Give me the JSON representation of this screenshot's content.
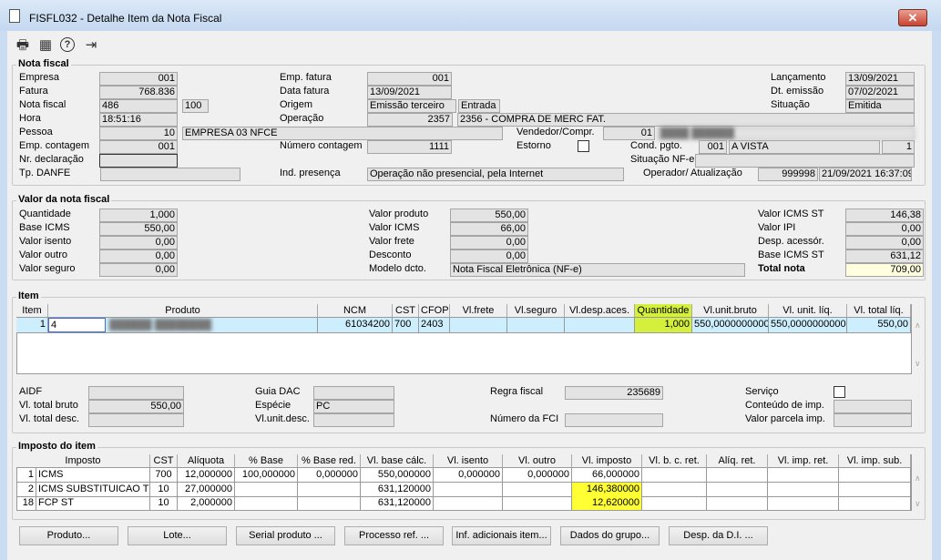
{
  "window": {
    "title": "FISFL032 - Detalhe Item da Nota Fiscal",
    "close": "✕"
  },
  "toolbar": {
    "print": "🖶",
    "calendar": "▦",
    "help": "?",
    "exit": "⇥"
  },
  "nota_fiscal": {
    "title": "Nota fiscal",
    "empresa_label": "Empresa",
    "empresa": "001",
    "fatura_label": "Fatura",
    "fatura": "768.836",
    "nota_label": "Nota fiscal",
    "nota": "486",
    "serie": "100",
    "hora_label": "Hora",
    "hora": "18:51:16",
    "pessoa_label": "Pessoa",
    "pessoa": "10",
    "pessoa_nome": "EMPRESA 03 NFCE",
    "emp_contagem_label": "Emp. contagem",
    "emp_contagem": "001",
    "nr_declaracao_label": "Nr. declaração",
    "nr_declaracao": "",
    "tp_danfe_label": "Tp. DANFE",
    "tp_danfe": "",
    "emp_fatura_label": "Emp. fatura",
    "emp_fatura": "001",
    "data_fatura_label": "Data fatura",
    "data_fatura": "13/09/2021",
    "origem_label": "Origem",
    "origem": "Emissão terceiro",
    "origem_tipo": "Entrada",
    "operacao_label": "Operação",
    "operacao": "2357",
    "operacao_desc": "2356 - COMPRA DE MERC FAT.",
    "numero_contagem_label": "Número contagem",
    "numero_contagem": "1111",
    "ind_presenca_label": "Ind. presença",
    "ind_presenca": "Operação não presencial, pela Internet",
    "vendedor_label": "Vendedor/Compr.",
    "vendedor": "01",
    "vendedor_nome": "████ ██████",
    "estorno_label": "Estorno",
    "estorno": false,
    "cond_pgto_label": "Cond. pgto.",
    "cond_pgto": "001",
    "cond_pgto_desc": "A VISTA",
    "cond_pgto_parcelas": "1",
    "situacao_nfe_label": "Situação NF-e",
    "situacao_nfe": "",
    "operador_label": "Operador/ Atualização",
    "operador": "999998",
    "atualizacao": "21/09/2021 16:37:09",
    "lancamento_label": "Lançamento",
    "lancamento": "13/09/2021",
    "dt_emissao_label": "Dt. emissão",
    "dt_emissao": "07/02/2021",
    "situacao_label": "Situação",
    "situacao": "Emitida"
  },
  "valor": {
    "title": "Valor da nota fiscal",
    "quantidade_label": "Quantidade",
    "quantidade": "1,000",
    "base_icms_label": "Base ICMS",
    "base_icms": "550,00",
    "valor_isento_label": "Valor isento",
    "valor_isento": "0,00",
    "valor_outro_label": "Valor outro",
    "valor_outro": "0,00",
    "valor_seguro_label": "Valor seguro",
    "valor_seguro": "0,00",
    "valor_produto_label": "Valor produto",
    "valor_produto": "550,00",
    "valor_icms_label": "Valor ICMS",
    "valor_icms": "66,00",
    "valor_frete_label": "Valor frete",
    "valor_frete": "0,00",
    "desconto_label": "Desconto",
    "desconto": "0,00",
    "modelo_label": "Modelo dcto.",
    "modelo": "Nota Fiscal Eletrônica (NF-e)",
    "icms_st_label": "Valor ICMS ST",
    "icms_st": "146,38",
    "ipi_label": "Valor IPI",
    "ipi": "0,00",
    "desp_label": "Desp. acessór.",
    "desp": "0,00",
    "base_st_label": "Base ICMS ST",
    "base_st": "631,12",
    "total_label": "Total nota",
    "total": "709,00"
  },
  "item": {
    "title": "Item",
    "columns": [
      "Item",
      "Produto",
      "NCM",
      "CST",
      "CFOP",
      "Vl.frete",
      "Vl.seguro",
      "Vl.desp.aces.",
      "Quantidade",
      "Vl.unit.bruto",
      "Vl. unit. líq.",
      "Vl. total líq."
    ],
    "rows": [
      [
        "1",
        "4",
        "██████ ████████",
        "61034200",
        "700",
        "2403",
        "",
        "",
        "",
        "1,000",
        "550,0000000000",
        "550,0000000000",
        "550,00"
      ]
    ],
    "highlight_color": "#d4f03c",
    "aidf_label": "AIDF",
    "aidf": "",
    "total_bruto_label": "Vl. total bruto",
    "total_bruto": "550,00",
    "total_desc_label": "Vl. total desc.",
    "total_desc": "",
    "guia_label": "Guia DAC",
    "guia": "",
    "especie_label": "Espécie",
    "especie": "PC",
    "unit_desc_label": "Vl.unit.desc.",
    "unit_desc": "",
    "regra_label": "Regra fiscal",
    "regra": "235689",
    "fci_label": "Número da FCI",
    "fci": "",
    "servico_label": "Serviço",
    "servico": false,
    "conteudo_label": "Conteúdo de imp.",
    "conteudo": "",
    "parcela_label": "Valor parcela imp.",
    "parcela": ""
  },
  "imposto": {
    "title": "Imposto do item",
    "columns": [
      "Imposto",
      "CST",
      "Alíquota",
      "% Base",
      "% Base red.",
      "Vl. base cálc.",
      "Vl. isento",
      "Vl. outro",
      "Vl. imposto",
      "Vl. b. c. ret.",
      "Alíq. ret.",
      "Vl. imp. ret.",
      "Vl. imp. sub."
    ],
    "rows": [
      [
        "1",
        "ICMS",
        "700",
        "12,000000",
        "100,000000",
        "0,000000",
        "550,000000",
        "0,000000",
        "0,000000",
        "66,000000",
        "",
        "",
        "",
        ""
      ],
      [
        "2",
        "ICMS SUBSTITUICAO TRIB",
        "10",
        "27,000000",
        "",
        "",
        "631,120000",
        "",
        "",
        "146,380000",
        "",
        "",
        "",
        ""
      ],
      [
        "18",
        "FCP ST",
        "10",
        "2,000000",
        "",
        "",
        "631,120000",
        "",
        "",
        "12,620000",
        "",
        "",
        "",
        ""
      ]
    ],
    "highlight_color": "#ffff33"
  },
  "buttons": [
    "Produto...",
    "Lote...",
    "Serial produto ...",
    "Processo ref. ...",
    "Inf. adicionais item...",
    "Dados do grupo...",
    "Desp. da D.I. ..."
  ]
}
